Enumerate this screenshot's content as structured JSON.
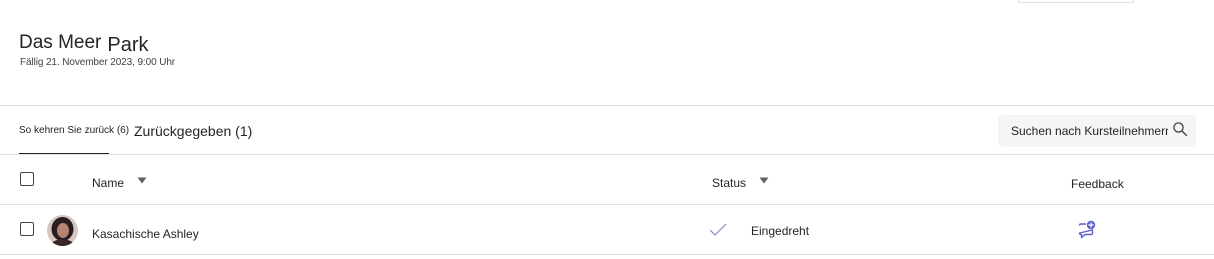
{
  "assignment": {
    "title_part1": "Das Meer",
    "title_part2": "Park",
    "due": "Fällig 21. November 2023, 9:00 Uhr"
  },
  "tabs": [
    {
      "label": "So kehren Sie zurück (6)",
      "selected": true
    },
    {
      "label": "Zurückgegeben (1)",
      "selected": false
    }
  ],
  "search": {
    "placeholder": "Suchen nach Kursteilnehmern",
    "icon": "search-icon"
  },
  "table": {
    "columns": {
      "name": "Name",
      "status": "Status",
      "feedback": "Feedback"
    },
    "rows": [
      {
        "name": "Kasachische Ashley",
        "status": "Eingedreht",
        "status_icon": "checkmark-icon",
        "feedback_icon": "add-feedback-icon",
        "selected": false
      }
    ]
  },
  "colors": {
    "accent": "#5b5fc7",
    "text": "#242424",
    "divider": "#e1e1e1"
  }
}
